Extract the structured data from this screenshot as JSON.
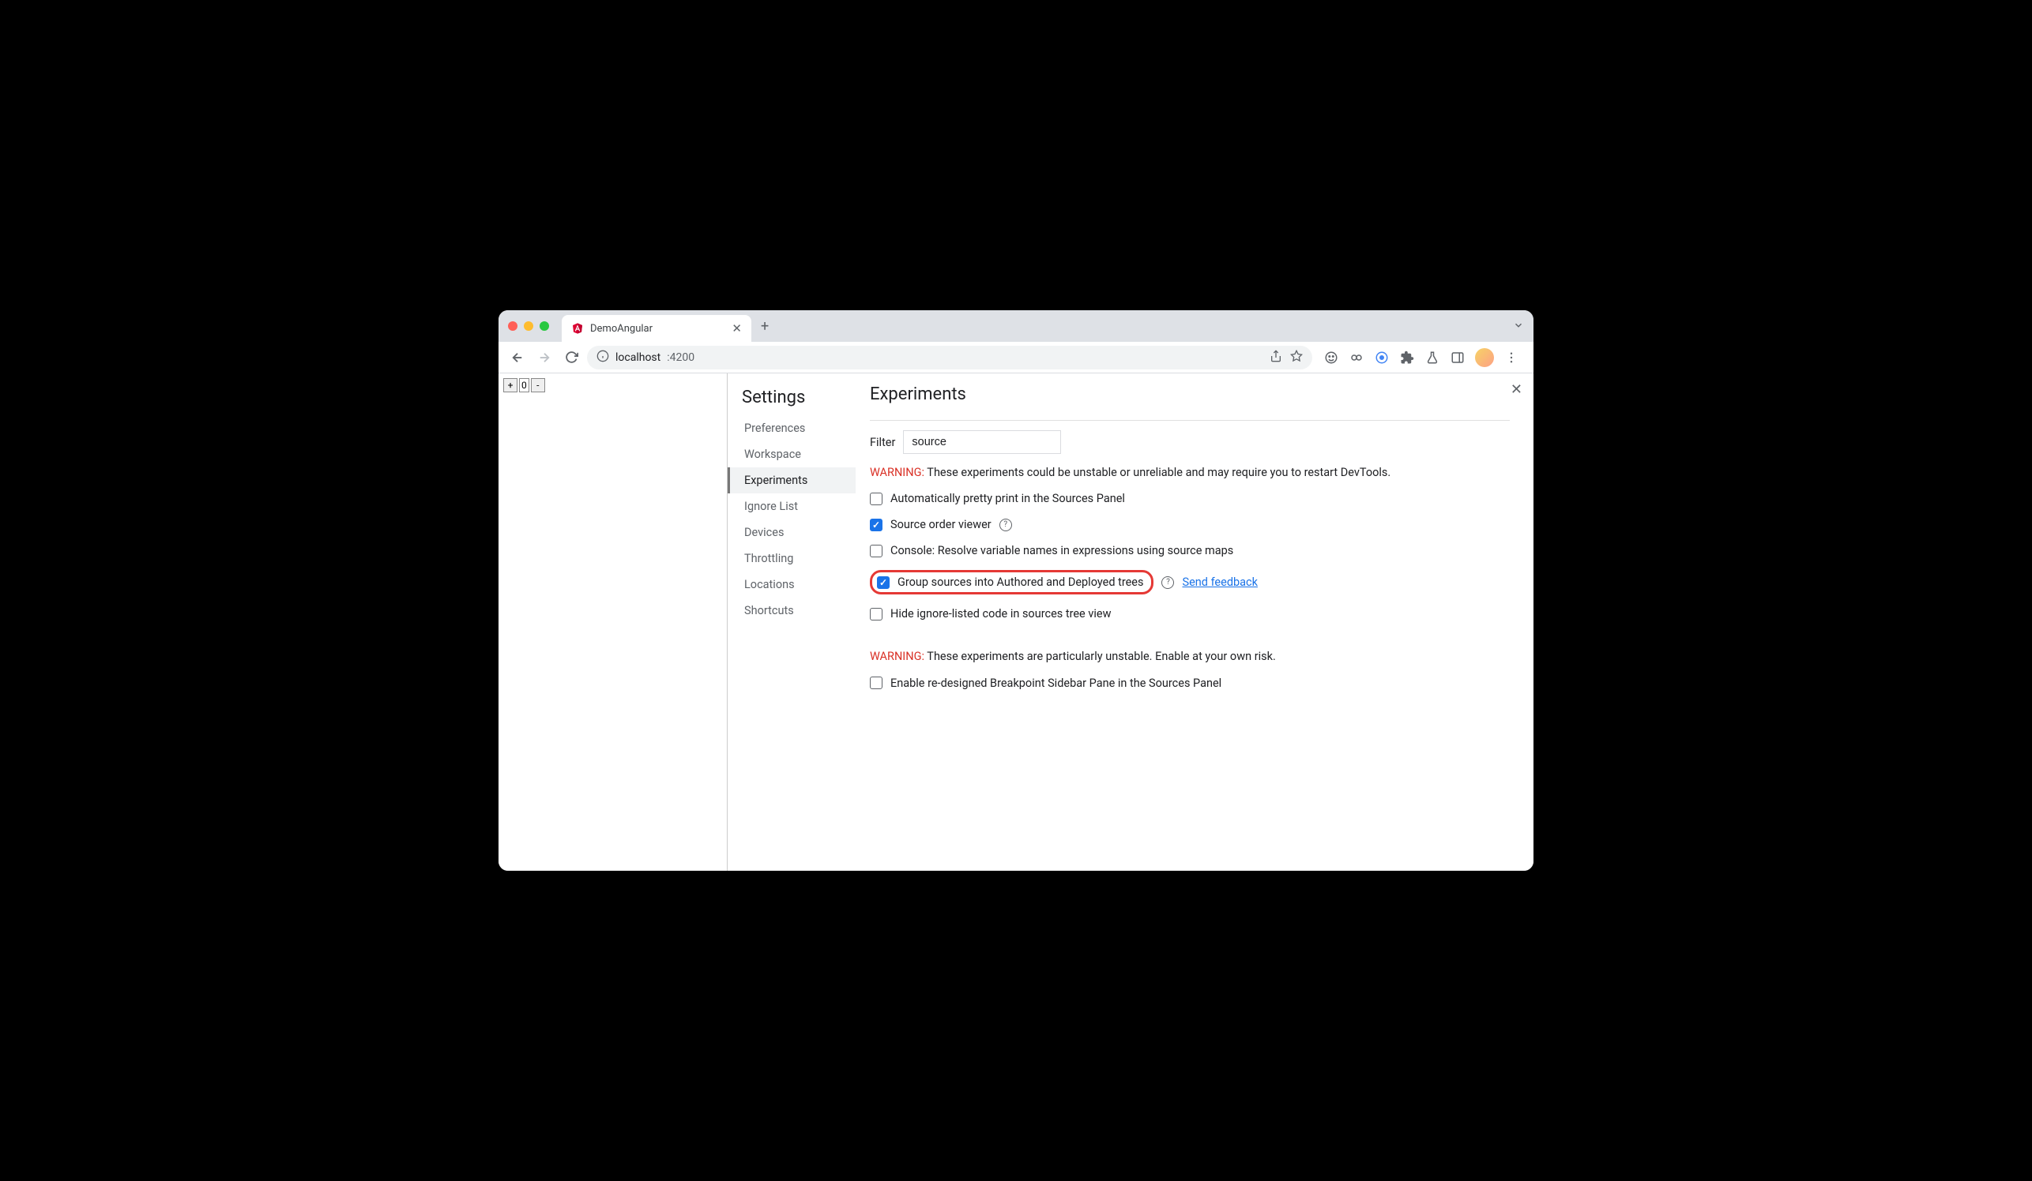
{
  "browser": {
    "tab": {
      "title": "DemoAngular"
    },
    "url": {
      "host": "localhost",
      "port": ":4200"
    }
  },
  "page": {
    "counter_value": "0",
    "plus": "+",
    "minus": "-"
  },
  "settings": {
    "title": "Settings",
    "items": [
      {
        "label": "Preferences"
      },
      {
        "label": "Workspace"
      },
      {
        "label": "Experiments"
      },
      {
        "label": "Ignore List"
      },
      {
        "label": "Devices"
      },
      {
        "label": "Throttling"
      },
      {
        "label": "Locations"
      },
      {
        "label": "Shortcuts"
      }
    ],
    "active_index": 2
  },
  "experiments": {
    "title": "Experiments",
    "filter_label": "Filter",
    "filter_value": "source",
    "warning1_label": "WARNING:",
    "warning1_text": " These experiments could be unstable or unreliable and may require you to restart DevTools.",
    "items": [
      {
        "label": "Automatically pretty print in the Sources Panel",
        "checked": false,
        "help": false
      },
      {
        "label": "Source order viewer",
        "checked": true,
        "help": true
      },
      {
        "label": "Console: Resolve variable names in expressions using source maps",
        "checked": false,
        "help": false
      },
      {
        "label": "Group sources into Authored and Deployed trees",
        "checked": true,
        "help": true,
        "highlighted": true,
        "feedback": "Send feedback"
      },
      {
        "label": "Hide ignore-listed code in sources tree view",
        "checked": false,
        "help": false
      }
    ],
    "warning2_label": "WARNING:",
    "warning2_text": " These experiments are particularly unstable. Enable at your own risk.",
    "unstable_items": [
      {
        "label": "Enable re-designed Breakpoint Sidebar Pane in the Sources Panel",
        "checked": false
      }
    ]
  }
}
